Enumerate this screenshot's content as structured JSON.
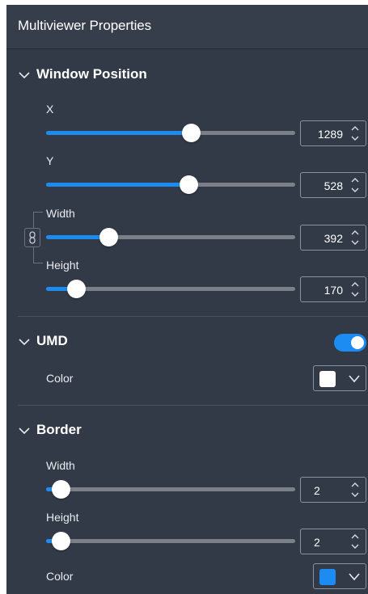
{
  "header": {
    "title": "Multiviewer Properties"
  },
  "window_position": {
    "title": "Window Position",
    "x": {
      "label": "X",
      "value": "1289",
      "slider_fraction": 0.58
    },
    "y": {
      "label": "Y",
      "value": "528",
      "slider_fraction": 0.57
    },
    "width": {
      "label": "Width",
      "value": "392",
      "slider_fraction": 0.25
    },
    "height": {
      "label": "Height",
      "value": "170",
      "slider_fraction": 0.12
    }
  },
  "umd": {
    "title": "UMD",
    "enabled": true,
    "color_label": "Color",
    "color": "#ffffff"
  },
  "border": {
    "title": "Border",
    "width": {
      "label": "Width",
      "value": "2",
      "slider_fraction": 0.06
    },
    "height": {
      "label": "Height",
      "value": "2",
      "slider_fraction": 0.06
    },
    "color_label": "Color",
    "color": "#1c8cf2"
  },
  "colors": {
    "accent": "#1c8cf2",
    "panel_bg": "#323a48",
    "header_bg": "#363e4c"
  },
  "icons": [
    "chevron-down-icon",
    "link-icon",
    "spin-up-icon",
    "spin-down-icon"
  ]
}
